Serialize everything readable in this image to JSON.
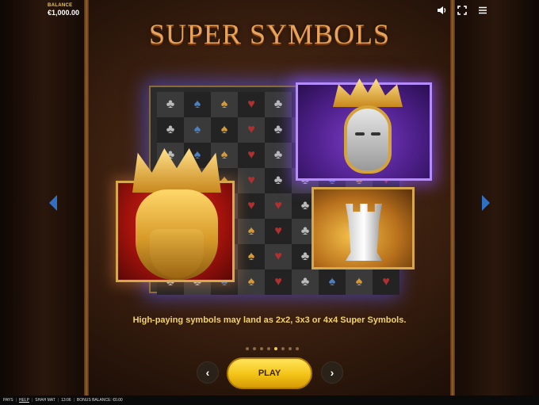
{
  "header": {
    "balance_label": "BALANCE",
    "balance_value": "€1,000.00",
    "icons": [
      "sound-icon",
      "fullscreen-icon",
      "menu-icon"
    ]
  },
  "title": "SUPER SYMBOLS",
  "description": "High-paying symbols may land as 2x2, 3x3 or 4x4 Super Symbols.",
  "pagination": {
    "total": 8,
    "active_index": 4
  },
  "buttons": {
    "play_label": "PLAY",
    "prev_glyph": "‹",
    "next_glyph": "›"
  },
  "footer": {
    "pays": "PAYS",
    "help": "HELP",
    "game": "SHAH MAT",
    "time": "13:06",
    "bonus_balance": "BONUS BALANCE: €0.00"
  },
  "colors": {
    "accent": "#f2c94c",
    "title": "#e8a25a",
    "play_button": "#f3c316"
  }
}
